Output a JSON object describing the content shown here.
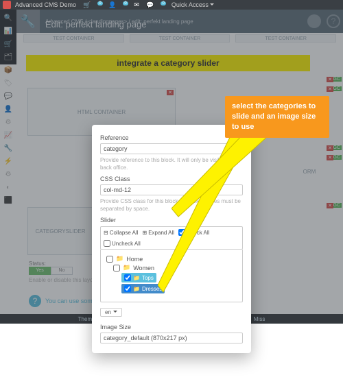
{
  "topbar": {
    "title": "Advanced CMS Demo",
    "quick": "Quick Access",
    "cart_badge": "0",
    "user_badge": "0",
    "chat_badge": "0"
  },
  "sidebar": {
    "items": [
      "🔍",
      "📊",
      "🛒",
      "🗂",
      "📦",
      "🏷",
      "💬",
      "👤",
      "⚙",
      "📈",
      "🔧",
      "⚡",
      "⚙",
      "◐",
      "⬛"
    ]
  },
  "page": {
    "crumb_small": "Advanced CMS / <landingpages> / edit: perfekt landing page",
    "title": "Edit: perfekt landing page",
    "test_container": "TEST CONTAINER",
    "html_container": "HTML CONTAINER",
    "categoryslider": "CATEGORYSLIDER",
    "orm": "ORM",
    "status_label": "Status:",
    "status_yes": "Yes",
    "status_no": "No",
    "status_hint": "Enable or disable this layout.",
    "tip": "You can use some"
  },
  "banner": {
    "text": "integrate a category slider"
  },
  "callout": {
    "text": "select the categories to slide and an image size to use"
  },
  "modal": {
    "reference_label": "Reference",
    "reference_value": "category",
    "reference_hint": "Provide reference to this block. It will only be visible in the back office.",
    "css_label": "CSS Class",
    "css_value": "col-md-12",
    "css_hint": "Provide CSS class for this block. Multiple classes must be separated by space.",
    "slider_label": "Slider",
    "collapse": "Collapse All",
    "expand": "Expand All",
    "check": "Check All",
    "uncheck": "Uncheck All",
    "tree": {
      "home": "Home",
      "women": "Women",
      "tops": "Tops",
      "dresses": "Dresses"
    },
    "lang": "en",
    "image_label": "Image Size",
    "image_value": "category_default (870x217 px)"
  },
  "footer": {
    "a": "Themes",
    "b": "Miss"
  }
}
